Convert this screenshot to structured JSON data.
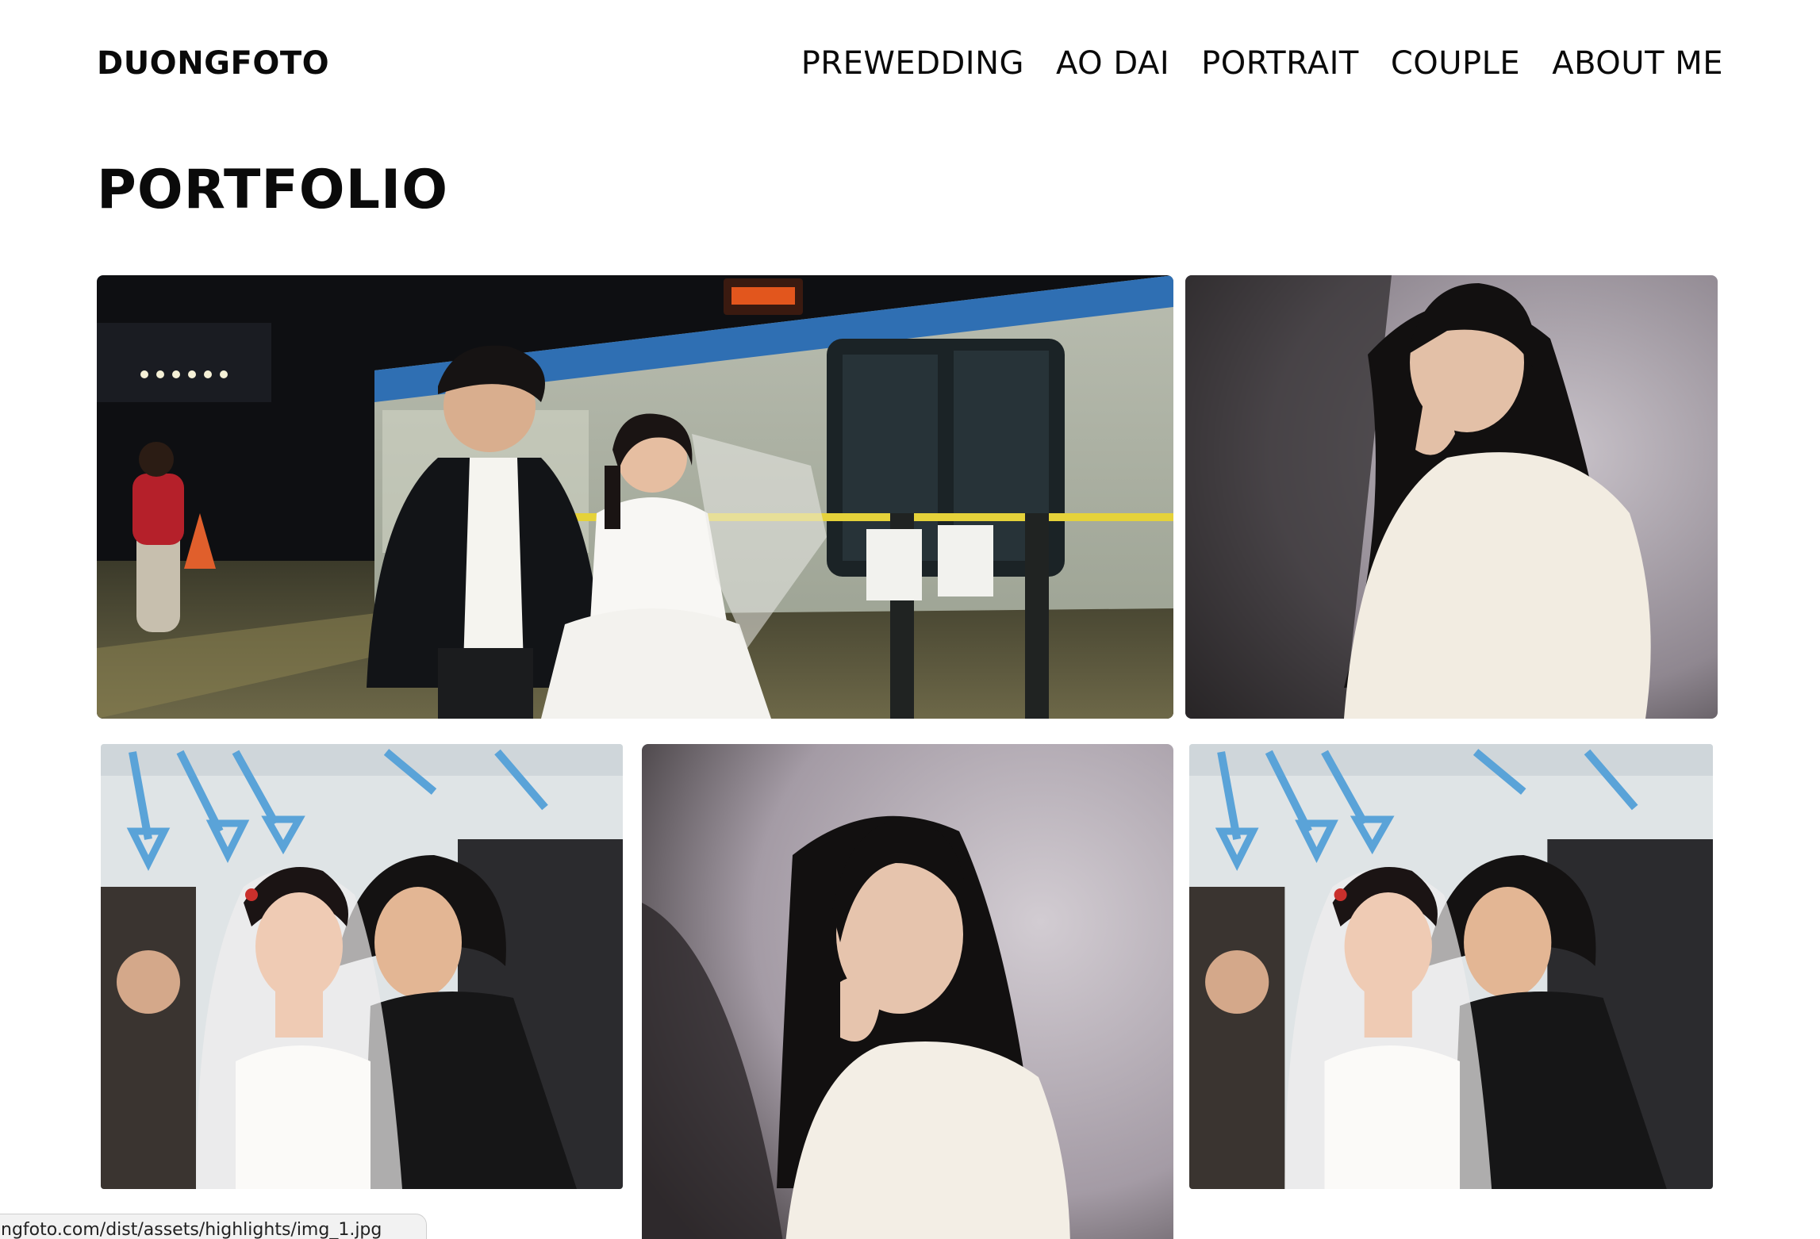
{
  "header": {
    "brand": "DUONGFOTO",
    "nav": [
      {
        "label": "PREWEDDING"
      },
      {
        "label": "AO DAI"
      },
      {
        "label": "PORTRAIT"
      },
      {
        "label": "COUPLE"
      },
      {
        "label": "ABOUT ME"
      }
    ]
  },
  "main": {
    "title": "PORTFOLIO"
  },
  "gallery": {
    "photos": [
      {
        "subject": "prewedding couple on metro platform"
      },
      {
        "subject": "portrait woman in white sweater"
      },
      {
        "subject": "prewedding couple in metro carriage"
      },
      {
        "subject": "portrait woman in white sweater close-up"
      },
      {
        "subject": "prewedding couple in metro carriage"
      }
    ]
  },
  "status_bar": {
    "url": "ngfoto.com/dist/assets/highlights/img_1.jpg"
  },
  "colors": {
    "text": "#0a0a0a",
    "background": "#ffffff"
  }
}
